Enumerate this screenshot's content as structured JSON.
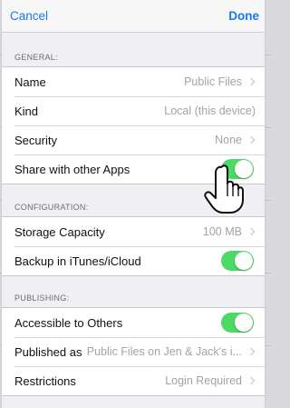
{
  "navbar": {
    "cancel_label": "Cancel",
    "done_label": "Done"
  },
  "sections": {
    "general": {
      "header": "GENERAL:",
      "name": {
        "label": "Name",
        "value": "Public Files"
      },
      "kind": {
        "label": "Kind",
        "value": "Local (this device)"
      },
      "security": {
        "label": "Security",
        "value": "None"
      },
      "share": {
        "label": "Share with other Apps",
        "on": true
      }
    },
    "configuration": {
      "header": "CONFIGURATION:",
      "storage": {
        "label": "Storage Capacity",
        "value": "100 MB"
      },
      "backup": {
        "label": "Backup in iTunes/iCloud",
        "on": true
      }
    },
    "publishing": {
      "header": "PUBLISHING:",
      "accessible": {
        "label": "Accessible to Others",
        "on": true
      },
      "published_as": {
        "label": "Published as",
        "value": "Public Files on Jen & Jack's i..."
      },
      "restrictions": {
        "label": "Restrictions",
        "value": "Login Required"
      }
    }
  },
  "colors": {
    "accent": "#1778f2",
    "toggle_on": "#4cd964",
    "group_bg": "#efeff4"
  },
  "icons": [
    "chevron-right-icon",
    "pointing-hand-icon"
  ]
}
